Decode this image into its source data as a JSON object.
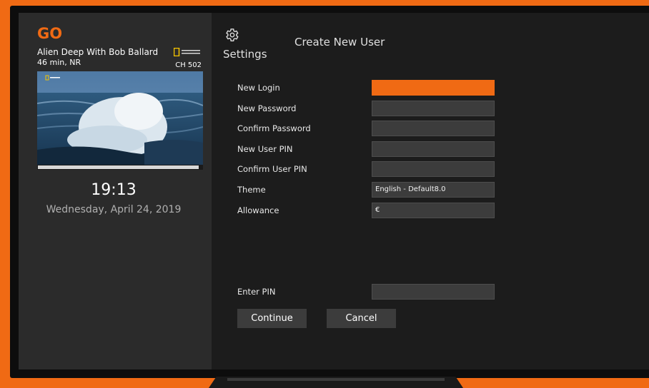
{
  "brand": {
    "logo_text": "GO",
    "accent_color": "#f06a14"
  },
  "now_playing": {
    "title": "Alien Deep With Bob Ballard",
    "meta": "46 min, NR",
    "channel": "CH 502",
    "network_logo": "NATIONAL GEOGRAPHIC",
    "progress": 0.98
  },
  "clock": {
    "time": "19:13",
    "date": "Wednesday, April 24, 2019"
  },
  "settings": {
    "label": "Settings",
    "icon": "gear-icon"
  },
  "form": {
    "title": "Create New User",
    "fields": [
      {
        "label": "New Login",
        "value": ""
      },
      {
        "label": "New Password",
        "value": ""
      },
      {
        "label": "Confirm Password",
        "value": ""
      },
      {
        "label": "New User PIN",
        "value": ""
      },
      {
        "label": "Confirm User PIN",
        "value": ""
      },
      {
        "label": "Theme",
        "value": "English - Default8.0"
      },
      {
        "label": "Allowance",
        "value": "€"
      }
    ],
    "pin": {
      "label": "Enter PIN",
      "value": ""
    },
    "continue_label": "Continue",
    "cancel_label": "Cancel"
  }
}
